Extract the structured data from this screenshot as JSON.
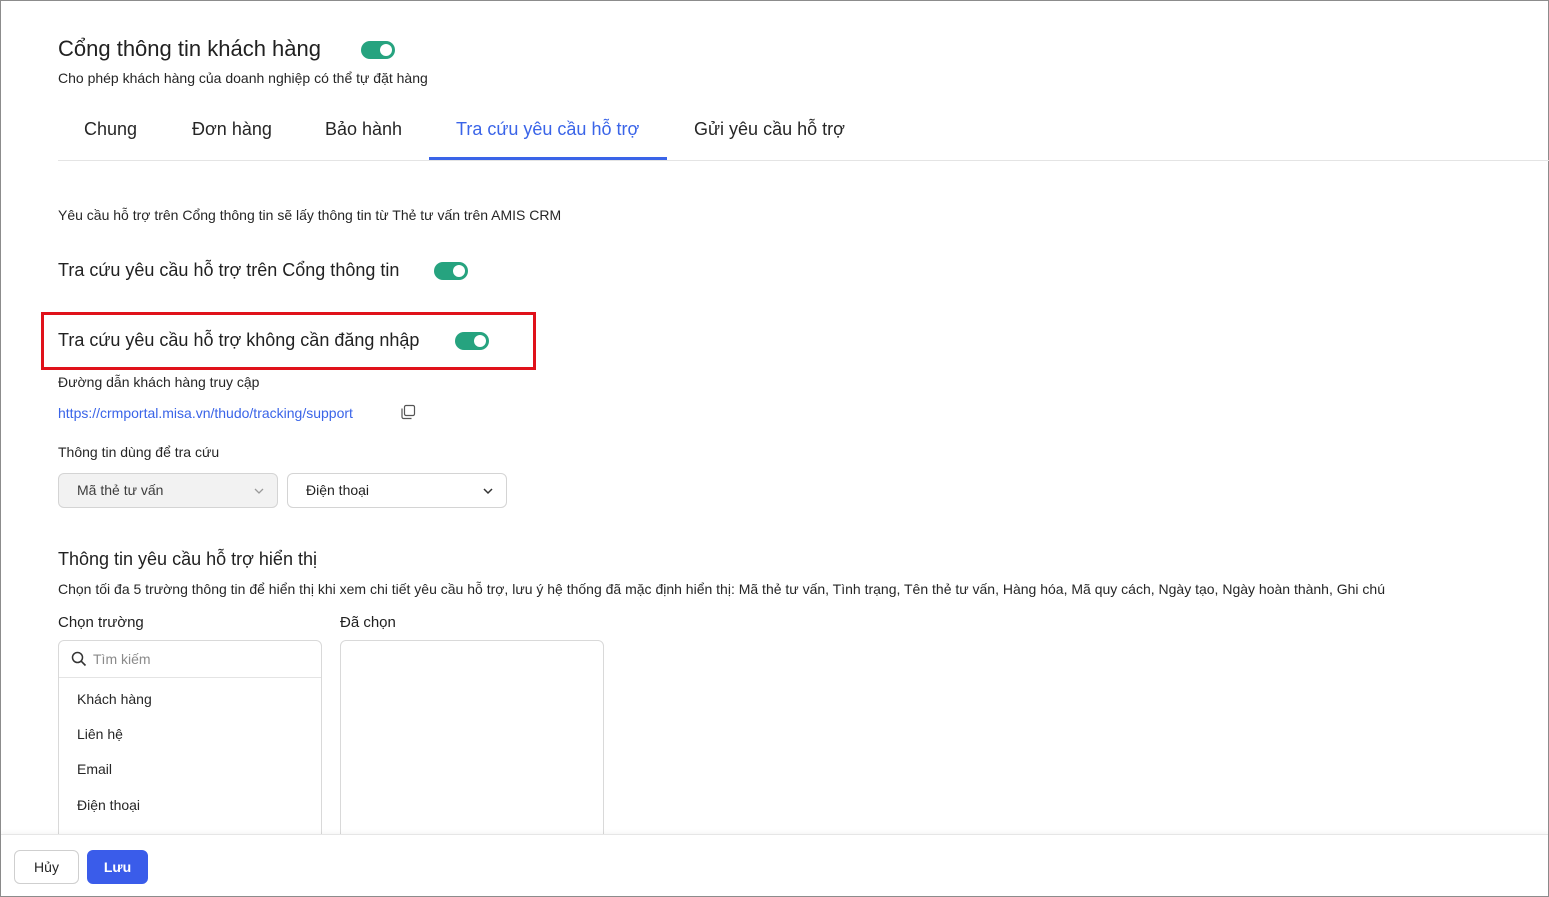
{
  "header": {
    "title": "Cổng thông tin khách hàng",
    "enabled": true,
    "subtitle": "Cho phép khách hàng của doanh nghiệp có thể tự đặt hàng"
  },
  "tabs": [
    {
      "label": "Chung",
      "active": false
    },
    {
      "label": "Đơn hàng",
      "active": false
    },
    {
      "label": "Bảo hành",
      "active": false
    },
    {
      "label": "Tra cứu yêu cầu hỗ trợ",
      "active": true
    },
    {
      "label": "Gửi yêu cầu hỗ trợ",
      "active": false
    }
  ],
  "content": {
    "info_text": "Yêu cầu hỗ trợ trên Cổng thông tin sẽ lấy thông tin từ Thẻ tư vấn trên AMIS CRM",
    "lookup_on_portal": {
      "label": "Tra cứu yêu cầu hỗ trợ trên Cổng thông tin",
      "enabled": true
    },
    "lookup_without_login": {
      "label": "Tra cứu yêu cầu hỗ trợ không cần đăng nhập",
      "enabled": true
    },
    "access_link_label": "Đường dẫn khách hàng truy cập",
    "access_link": "https://crmportal.misa.vn/thudo/tracking/support",
    "lookup_info_label": "Thông tin dùng để tra cứu",
    "lookup_field_1": "Mã thẻ tư vấn",
    "lookup_field_2": "Điện thoại",
    "display_section_title": "Thông tin yêu cầu hỗ trợ hiển thị",
    "display_section_desc": "Chọn tối đa 5 trường thông tin để hiển thị khi xem chi tiết yêu cầu hỗ trợ, lưu ý hệ thống đã mặc định hiển thị: Mã thẻ tư vấn, Tình trạng, Tên thẻ tư vấn, Hàng hóa, Mã quy cách, Ngày tạo, Ngày hoàn thành, Ghi chú",
    "choose_fields_label": "Chọn trường",
    "selected_label": "Đã chọn",
    "search_placeholder": "Tìm kiếm",
    "field_options": [
      "Khách hàng",
      "Liên hệ",
      "Email",
      "Điện thoại"
    ]
  },
  "footer": {
    "cancel_label": "Hủy",
    "save_label": "Lưu"
  },
  "colors": {
    "accent": "#3a64e8",
    "toggle_on": "#26a37f",
    "highlight": "#e0111a",
    "save_button": "#3a5cea"
  }
}
